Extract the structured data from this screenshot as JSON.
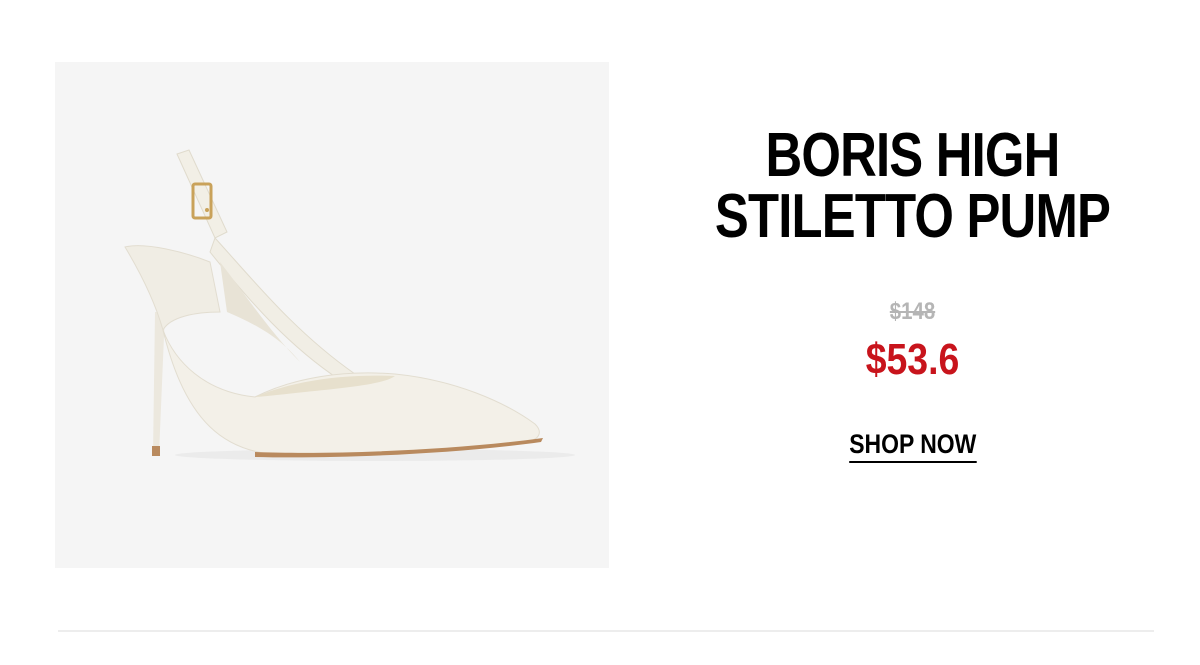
{
  "product": {
    "name": "BORIS HIGH\nSTILETTO PUMP",
    "original_price": "$148",
    "sale_price": "$53.6",
    "cta_label": "SHOP NOW",
    "image_subject": "white pointed-toe slingback stiletto pump"
  },
  "colors": {
    "sale_price": "#c8141c",
    "original_price": "#b5b5b5",
    "image_background": "#f5f5f5",
    "divider": "#ededed"
  }
}
